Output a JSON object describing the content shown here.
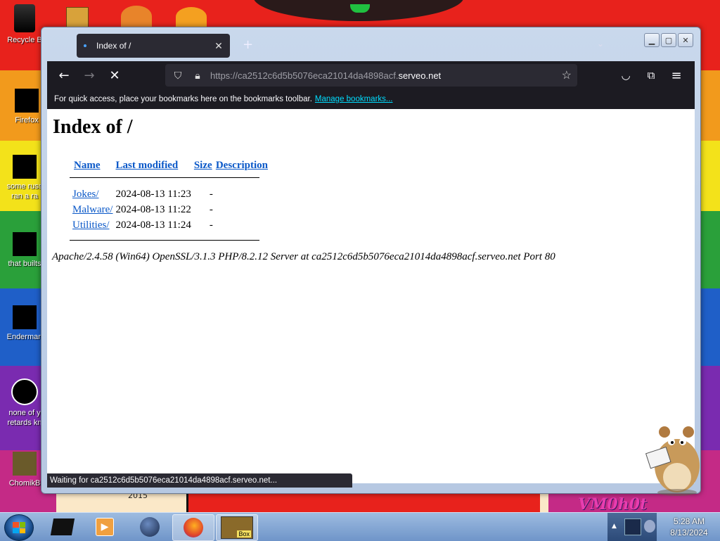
{
  "desktop": {
    "icons": [
      {
        "label": "Recycle Bin",
        "shown": "Recycle B"
      },
      {
        "label": "Firefox",
        "shown": "Firefox"
      },
      {
        "label": "some russ... ran a ra...",
        "shown": "some russ"
      },
      {
        "label": "that builts",
        "shown": "that builts"
      },
      {
        "label": "Enderman",
        "shown": "Enderman"
      },
      {
        "label": "none of y retards kn",
        "shown": "none of y"
      },
      {
        "label": "ChomikB",
        "shown": "ChomikB"
      }
    ],
    "icon_lines": {
      "some_second": "ran a ra",
      "none_second": "retards kn"
    },
    "year_text": "2015",
    "watermark": "VM0h0t"
  },
  "browser": {
    "tab_title": "Index of /",
    "tab_close": "✕",
    "new_tab": "+",
    "url_dim_prefix": "https://ca2512c6d5b5076eca21014da4898acf.",
    "url_domain": "serveo.net",
    "bookmarks_message": "For quick access, place your bookmarks here on the bookmarks toolbar.",
    "bookmarks_link": "Manage bookmarks...",
    "status": "Waiting for ca2512c6d5b5076eca21014da4898acf.serveo.net...",
    "icons": {
      "back": "back-icon",
      "forward": "forward-icon",
      "stop": "stop-icon",
      "shield": "shield-icon",
      "lock": "lock-icon",
      "bookmark_star": "star-icon",
      "pocket": "pocket-icon",
      "extensions": "extensions-icon",
      "menu": "hamburger-menu-icon"
    }
  },
  "page": {
    "heading": "Index of /",
    "columns": {
      "name": "Name",
      "last_modified": "Last modified",
      "size": "Size",
      "description": "Description"
    },
    "rows": [
      {
        "name": "Jokes/",
        "modified": "2024-08-13 11:23",
        "size": "-",
        "description": ""
      },
      {
        "name": "Malware/",
        "modified": "2024-08-13 11:22",
        "size": "-",
        "description": ""
      },
      {
        "name": "Utilities/",
        "modified": "2024-08-13 11:24",
        "size": "-",
        "description": ""
      }
    ],
    "address": "Apache/2.4.58 (Win64) OpenSSL/3.1.3 PHP/8.2.12 Server at ca2512c6d5b5076eca21014da4898acf.serveo.net Port 80"
  },
  "taskbar": {
    "time": "5:28 AM",
    "date": "8/13/2024",
    "sandbox_label": "Box"
  },
  "colors": {
    "firefox_dark": "#1c1b22",
    "link_blue": "#0a58c8",
    "bookmark_link": "#00ddff"
  }
}
